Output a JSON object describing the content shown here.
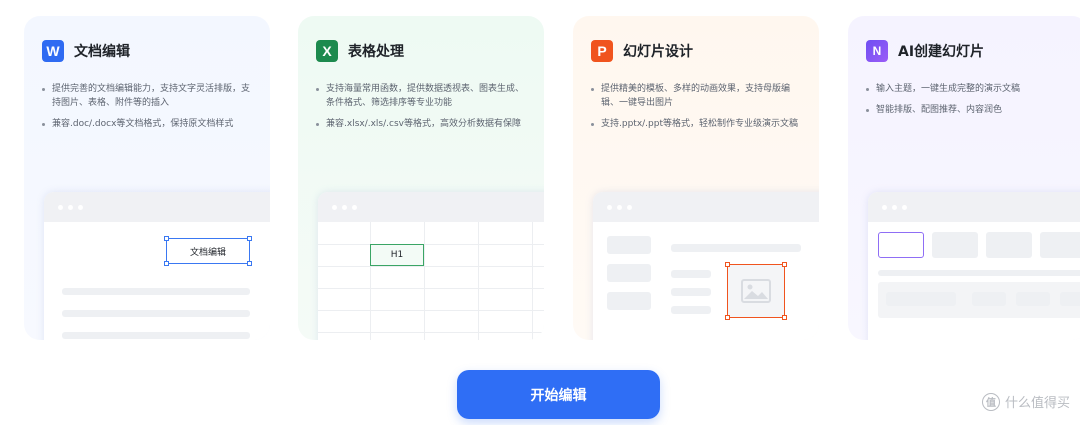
{
  "cards": [
    {
      "icon_letter": "W",
      "title": "文档编辑",
      "features": [
        "提供完善的文档编辑能力，支持文字灵活排版，支持图片、表格、附件等的插入",
        "兼容.doc/.docx等文档格式，保持原文档样式"
      ],
      "mock_label": "文档编辑"
    },
    {
      "icon_letter": "X",
      "title": "表格处理",
      "features": [
        "支持海量常用函数，提供数据透视表、图表生成、条件格式、筛选排序等专业功能",
        "兼容.xlsx/.xls/.csv等格式，高效分析数据有保障"
      ],
      "mock_label": "H1"
    },
    {
      "icon_letter": "P",
      "title": "幻灯片设计",
      "features": [
        "提供精美的模板、多样的动画效果，支持母版编辑、一键导出图片",
        "支持.pptx/.ppt等格式，轻松制作专业级演示文稿"
      ]
    },
    {
      "icon_letter": "N",
      "title": "AI创建幻灯片",
      "features": [
        "输入主题，一键生成完整的演示文稿",
        "智能排版、配图推荐、内容润色"
      ]
    }
  ],
  "start_button": "开始编辑",
  "watermark": {
    "glyph": "值",
    "text": "什么值得买"
  },
  "colors": {
    "primary": "#2f6ef5",
    "word": "#2f6bf2",
    "excel": "#1d8a4e",
    "ppt": "#f0541e",
    "ai": "#7a52f4"
  }
}
